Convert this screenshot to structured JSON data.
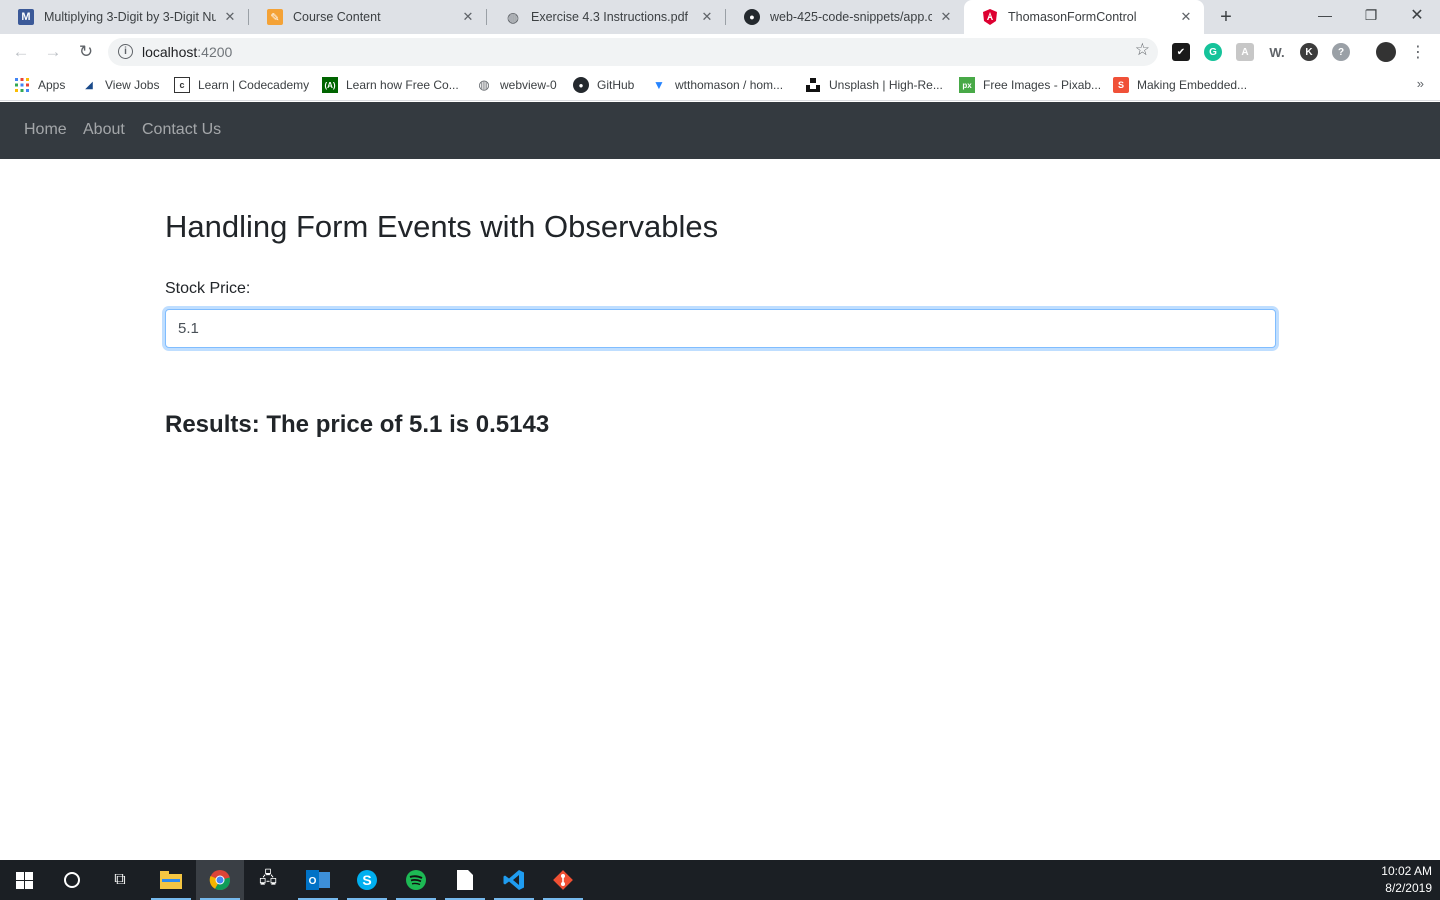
{
  "browser": {
    "tabs": [
      {
        "title": "Multiplying 3-Digit by 3-Digit Nu",
        "icon": "medium-m-icon",
        "active": false
      },
      {
        "title": "Course Content",
        "icon": "course-pencil-icon",
        "active": false
      },
      {
        "title": "Exercise 4.3 Instructions.pdf",
        "icon": "globe-icon",
        "active": false
      },
      {
        "title": "web-425-code-snippets/app.com",
        "icon": "github-icon",
        "active": false
      },
      {
        "title": "ThomasonFormControl",
        "icon": "angular-icon",
        "active": true
      }
    ],
    "new_tab_label": "+",
    "url_host": "localhost",
    "url_port": ":4200",
    "bookmarks": [
      {
        "label": "Apps",
        "icon": "apps-grid-icon"
      },
      {
        "label": "View Jobs",
        "icon": "jobs-icon"
      },
      {
        "label": "Learn | Codecademy",
        "icon": "codecademy-icon"
      },
      {
        "label": "Learn how Free Co...",
        "icon": "freecodecamp-icon"
      },
      {
        "label": "webview-0",
        "icon": "globe-icon"
      },
      {
        "label": "GitHub",
        "icon": "github-icon"
      },
      {
        "label": "wtthomason / hom...",
        "icon": "bitbucket-icon"
      },
      {
        "label": "Unsplash | High-Re...",
        "icon": "unsplash-icon"
      },
      {
        "label": "Free Images - Pixab...",
        "icon": "pixabay-icon"
      },
      {
        "label": "Making Embedded...",
        "icon": "swift-icon"
      }
    ]
  },
  "app": {
    "nav": [
      "Home",
      "About",
      "Contact Us"
    ],
    "title": "Handling Form Events with Observables",
    "field_label": "Stock Price:",
    "input_value": "5.1",
    "results": "Results: The price of 5.1 is 0.5143"
  },
  "taskbar": {
    "time": "10:02 AM",
    "date": "8/2/2019"
  },
  "colors": {
    "navbar": "#343a40",
    "input_focus": "#80bdff",
    "angular_red": "#dd0031"
  }
}
